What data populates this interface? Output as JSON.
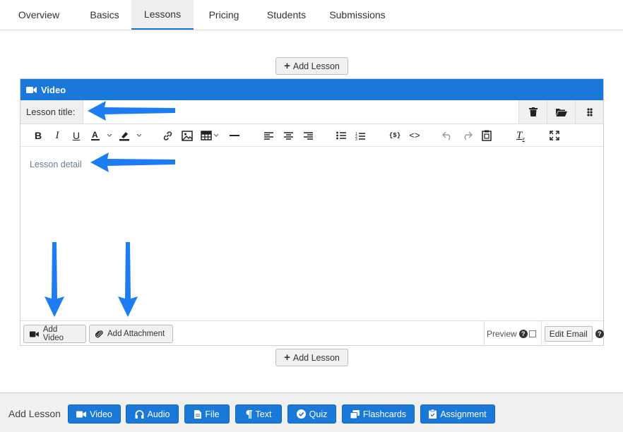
{
  "tabs": [
    {
      "label": "Overview"
    },
    {
      "label": "Basics"
    },
    {
      "label": "Lessons"
    },
    {
      "label": "Pricing"
    },
    {
      "label": "Students"
    },
    {
      "label": "Submissions"
    }
  ],
  "active_tab": "Lessons",
  "add_lesson_label": "Add Lesson",
  "panel": {
    "title": "Video",
    "lesson_title_label": "Lesson title:",
    "lesson_title_value": "",
    "detail_placeholder": "Lesson detail",
    "add_video_label": "Add Video",
    "add_attachment_label": "Add Attachment",
    "preview_label": "Preview",
    "edit_email_label": "Edit Email"
  },
  "toolbar_icons": [
    "bold-icon",
    "italic-icon",
    "underline-icon",
    "text-color-icon",
    "highlight-icon",
    "link-icon",
    "image-icon",
    "table-icon",
    "horizontal-rule-icon",
    "align-left-icon",
    "align-center-icon",
    "align-right-icon",
    "bullet-list-icon",
    "numbered-list-icon",
    "variable-icon",
    "source-code-icon",
    "undo-icon",
    "redo-icon",
    "paste-icon",
    "clear-format-icon",
    "fullscreen-icon"
  ],
  "footer": {
    "label": "Add Lesson",
    "buttons": [
      {
        "label": "Video",
        "icon": "video-icon"
      },
      {
        "label": "Audio",
        "icon": "headphones-icon"
      },
      {
        "label": "File",
        "icon": "file-icon"
      },
      {
        "label": "Text",
        "icon": "paragraph-icon"
      },
      {
        "label": "Quiz",
        "icon": "check-circle-icon"
      },
      {
        "label": "Flashcards",
        "icon": "cards-icon"
      },
      {
        "label": "Assignment",
        "icon": "clipboard-icon"
      }
    ]
  },
  "colors": {
    "primary": "#1a78d8",
    "arrow": "#1e7cf2"
  }
}
